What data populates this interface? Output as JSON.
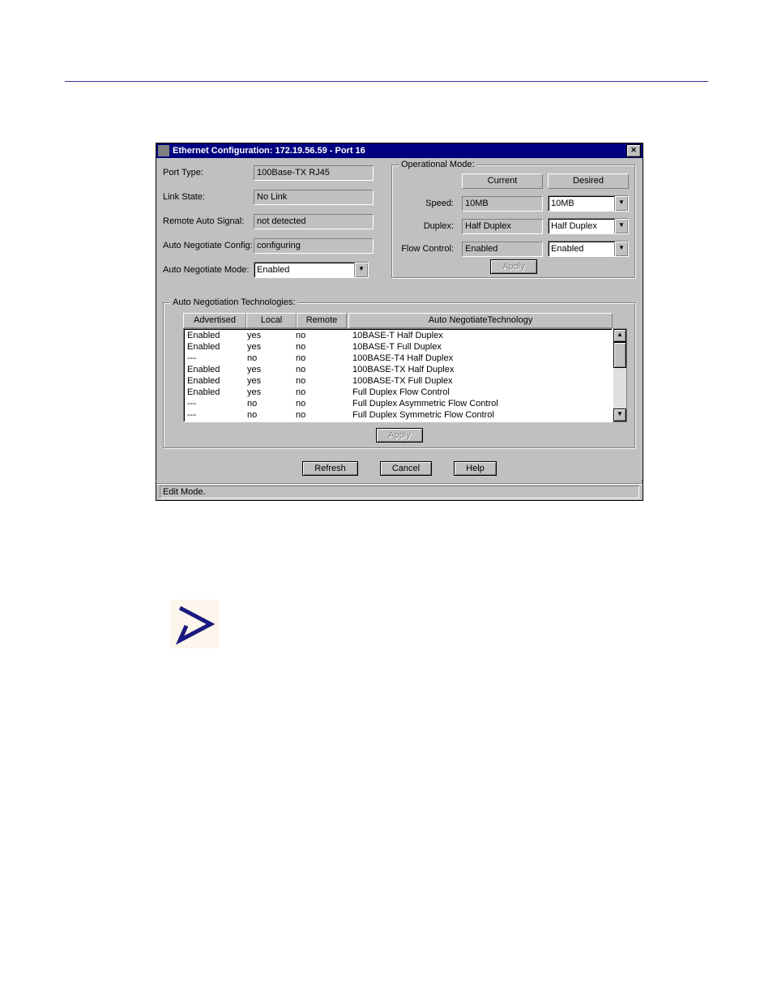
{
  "window": {
    "title": "Ethernet Configuration: 172.19.56.59 - Port 16"
  },
  "left": {
    "port_type_label": "Port Type:",
    "port_type_value": "100Base-TX RJ45",
    "link_state_label": "Link State:",
    "link_state_value": "No Link",
    "remote_auto_signal_label": "Remote Auto Signal:",
    "remote_auto_signal_value": "not detected",
    "auto_neg_config_label": "Auto Negotiate Config:",
    "auto_neg_config_value": "configuring",
    "auto_neg_mode_label": "Auto Negotiate Mode:",
    "auto_neg_mode_value": "Enabled"
  },
  "op": {
    "group_title": "Operational Mode:",
    "current_header": "Current",
    "desired_header": "Desired",
    "speed_label": "Speed:",
    "speed_current": "10MB",
    "speed_desired": "10MB",
    "duplex_label": "Duplex:",
    "duplex_current": "Half Duplex",
    "duplex_desired": "Half Duplex",
    "flow_label": "Flow Control:",
    "flow_current": "Enabled",
    "flow_desired": "Enabled",
    "apply_label": "Apply"
  },
  "autoneg": {
    "group_title": "Auto Negotiation Technologies:",
    "headers": {
      "advertised": "Advertised",
      "local": "Local",
      "remote": "Remote",
      "tech": "Auto NegotiateTechnology"
    },
    "rows": [
      {
        "advertised": "Enabled",
        "local": "yes",
        "remote": "no",
        "tech": "10BASE-T Half Duplex"
      },
      {
        "advertised": "Enabled",
        "local": "yes",
        "remote": "no",
        "tech": "10BASE-T Full Duplex"
      },
      {
        "advertised": "---",
        "local": "no",
        "remote": "no",
        "tech": "100BASE-T4 Half Duplex"
      },
      {
        "advertised": "Enabled",
        "local": "yes",
        "remote": "no",
        "tech": "100BASE-TX Half Duplex"
      },
      {
        "advertised": "Enabled",
        "local": "yes",
        "remote": "no",
        "tech": "100BASE-TX Full Duplex"
      },
      {
        "advertised": "Enabled",
        "local": "yes",
        "remote": "no",
        "tech": "Full Duplex Flow Control"
      },
      {
        "advertised": "---",
        "local": "no",
        "remote": "no",
        "tech": "Full Duplex Asymmetric Flow Control"
      },
      {
        "advertised": "---",
        "local": "no",
        "remote": "no",
        "tech": "Full Duplex Symmetric Flow Control"
      }
    ],
    "apply_label": "Apply"
  },
  "buttons": {
    "refresh": "Refresh",
    "cancel": "Cancel",
    "help": "Help"
  },
  "status": "Edit Mode."
}
